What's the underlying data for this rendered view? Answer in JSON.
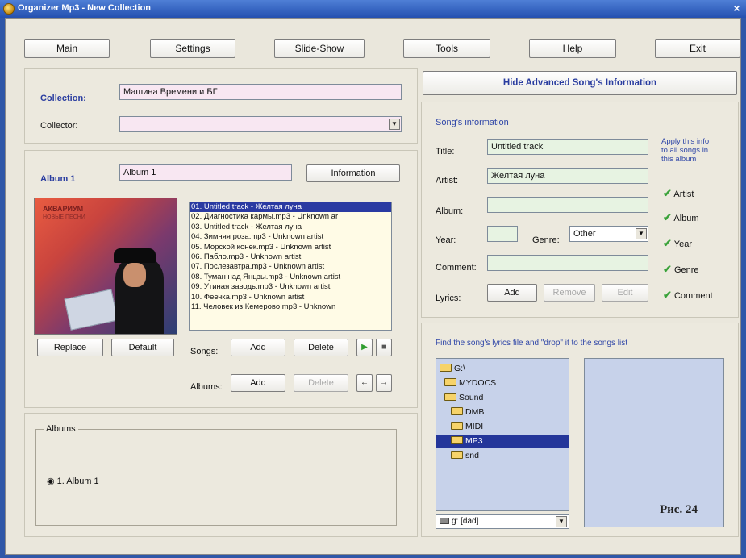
{
  "window": {
    "title": "Organizer Mp3 - New Collection",
    "close_glyph": "×"
  },
  "menu": {
    "main": "Main",
    "settings": "Settings",
    "slide_show": "Slide-Show",
    "tools": "Tools",
    "help": "Help",
    "exit": "Exit"
  },
  "collection": {
    "collection_label": "Collection:",
    "collection_value": "Машина Времени и БГ",
    "collector_label": "Collector:",
    "collector_value": ""
  },
  "album": {
    "label": "Album 1",
    "name_value": "Album 1",
    "information_button": "Information",
    "art_title": "АКВАРИУМ",
    "art_subtitle": "НОВЫЕ ПЕСНИ",
    "replace_button": "Replace",
    "default_button": "Default",
    "songs_label": "Songs:",
    "albums_label": "Albums:",
    "add_song_button": "Add",
    "delete_song_button": "Delete",
    "add_album_button": "Add",
    "delete_album_button": "Delete",
    "play_glyph": "▶",
    "stop_glyph": "■",
    "prev_glyph": "←",
    "next_glyph": "→",
    "songs": [
      "01. Untitled track - Желтая луна",
      "02. Диагностика кармы.mp3 - Unknown ar",
      "03. Untitled track - Желтая луна",
      "04. Зимняя роза.mp3 - Unknown artist",
      "05. Морской конек.mp3 - Unknown artist",
      "06. Пабло.mp3 - Unknown artist",
      "07. Послезавтра.mp3 - Unknown artist",
      "08. Туман над Янцзы.mp3 - Unknown artist",
      "09. Утиная заводь.mp3 - Unknown artist",
      "10. Феечка.mp3 - Unknown artist",
      "11. Человек из Кемерово.mp3 - Unknown"
    ],
    "selected_song_index": 0
  },
  "albums_panel": {
    "legend": "Albums",
    "radio_glyph": "◉",
    "item_label": "1. Album 1"
  },
  "song_info": {
    "toggle_button": "Hide Advanced Song's Information",
    "section_title": "Song's information",
    "title_label": "Title:",
    "title_value": "Untitled track",
    "artist_label": "Artist:",
    "artist_value": "Желтая луна",
    "album_label": "Album:",
    "album_value": "",
    "year_label": "Year:",
    "year_value": "",
    "genre_label": "Genre:",
    "genre_value": "Other",
    "comment_label": "Comment:",
    "comment_value": "",
    "lyrics_label": "Lyrics:",
    "add_button": "Add",
    "remove_button": "Remove",
    "edit_button": "Edit",
    "apply_note": [
      "Apply this info",
      "to all songs in",
      "this album"
    ],
    "check_glyph": "✔",
    "apply_items": [
      "Artist",
      "Album",
      "Year",
      "Genre",
      "Comment"
    ]
  },
  "lyrics_browser": {
    "hint": "Find the song's lyrics file and \"drop\" it to the songs list",
    "tree": [
      "G:\\",
      "MYDOCS",
      "Sound",
      "DMB",
      "MIDI",
      "MP3",
      "snd"
    ],
    "selected_folder": "MP3",
    "drive_value": "g: [dad]"
  },
  "figure_caption": "Рис. 24"
}
